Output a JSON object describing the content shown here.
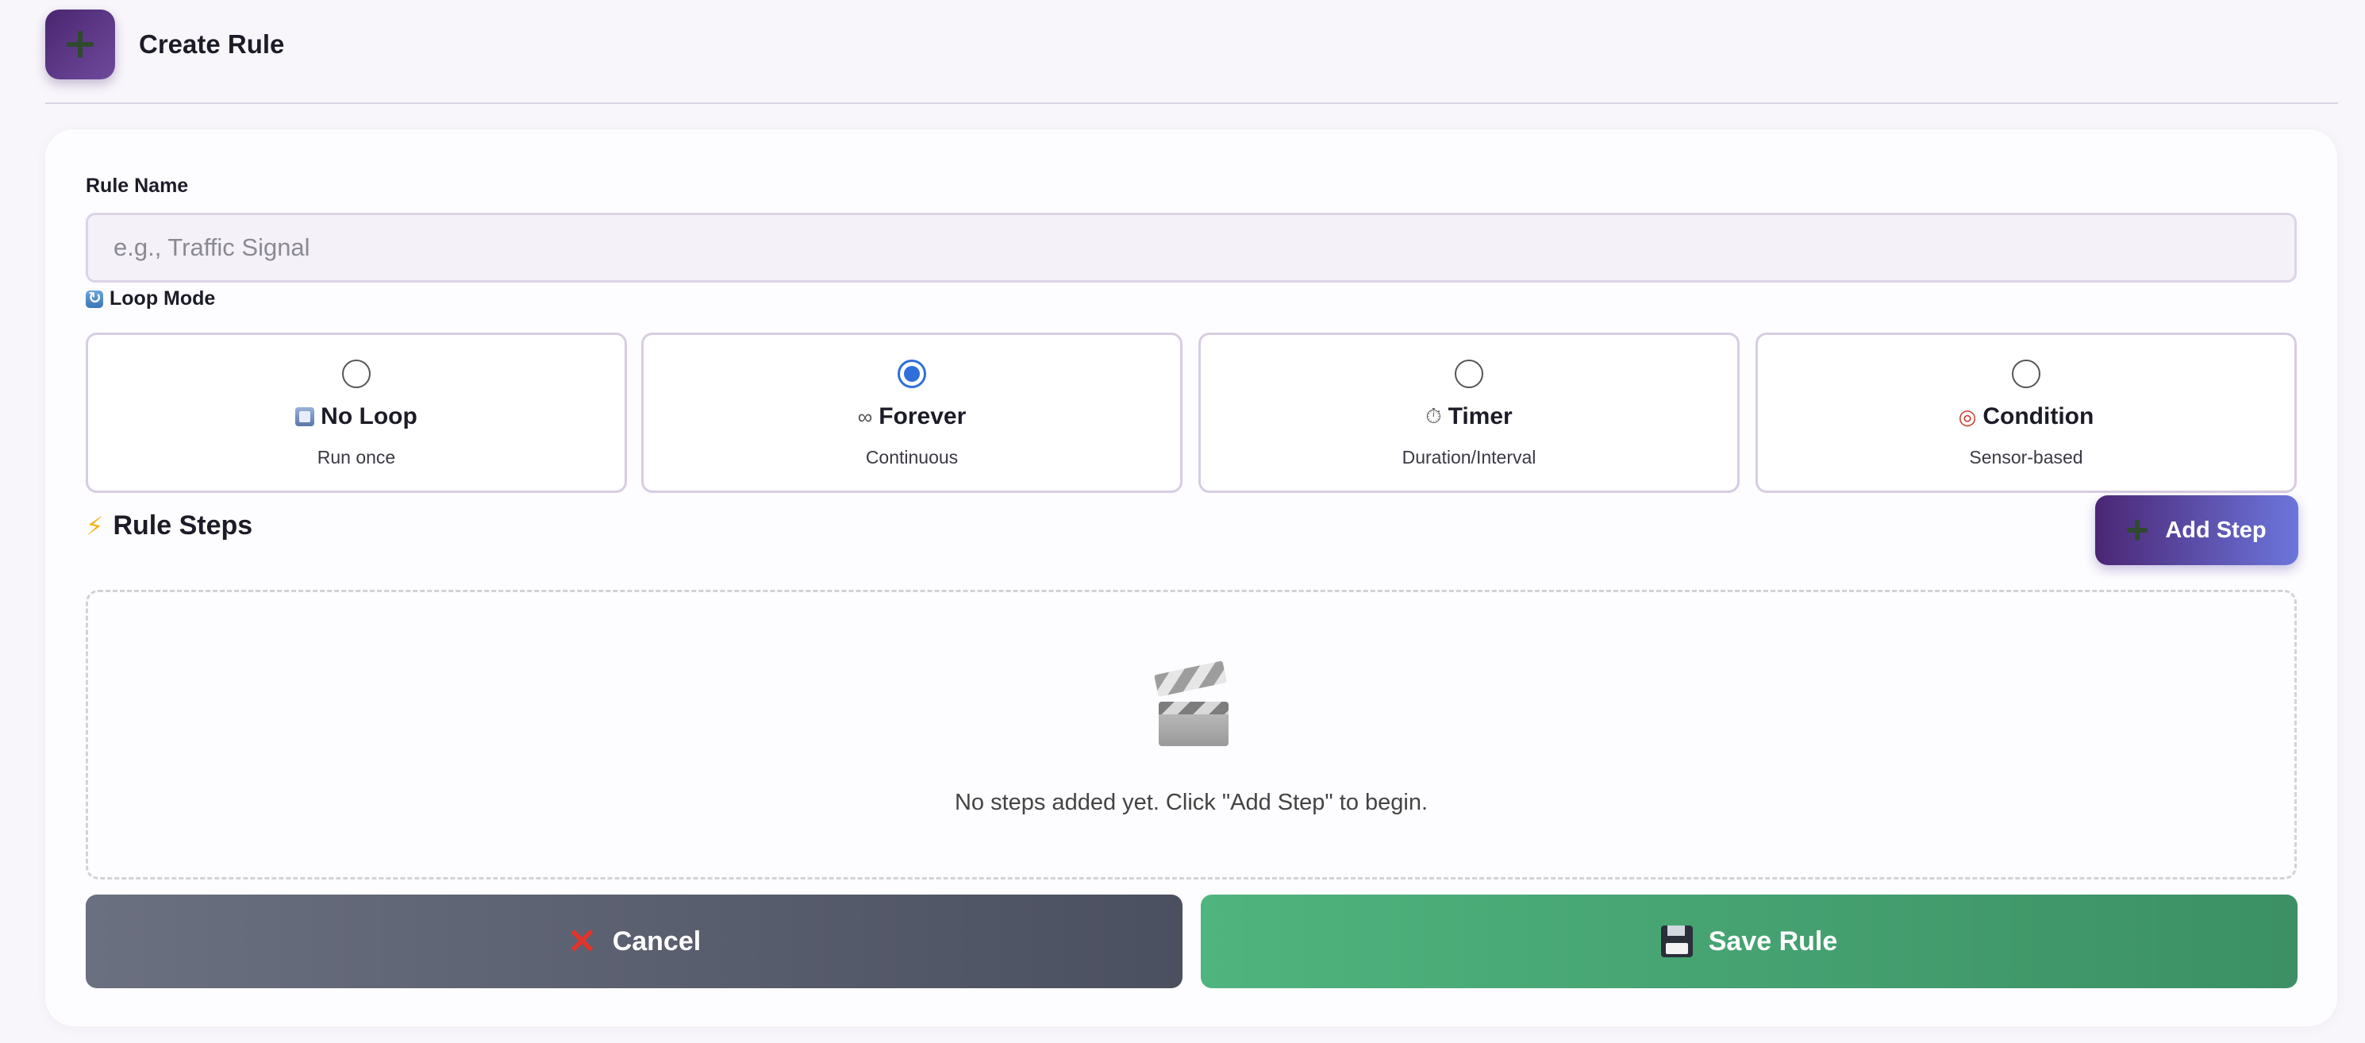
{
  "header": {
    "title": "Create Rule",
    "icon": "plus-icon"
  },
  "form": {
    "rule_name_label": "Rule Name",
    "rule_name_placeholder": "e.g., Traffic Signal",
    "rule_name_value": "",
    "loop_mode_label": "Loop Mode",
    "loop_options": [
      {
        "icon": "stop-square-icon",
        "title": "No Loop",
        "subtitle": "Run once",
        "selected": false
      },
      {
        "icon": "infinity-icon",
        "title": "Forever",
        "subtitle": "Continuous",
        "selected": true
      },
      {
        "icon": "stopwatch-icon",
        "title": "Timer",
        "subtitle": "Duration/Interval",
        "selected": false
      },
      {
        "icon": "target-icon",
        "title": "Condition",
        "subtitle": "Sensor-based",
        "selected": false
      }
    ],
    "steps_title": "Rule Steps",
    "add_step_label": "Add Step",
    "empty_steps_text": "No steps added yet. Click \"Add Step\" to begin.",
    "cancel_label": "Cancel",
    "save_label": "Save Rule"
  },
  "colors": {
    "accent_purple": "#4b2674",
    "radio_blue": "#2f6fd9",
    "save_green": "#4fb47e",
    "cancel_gray": "#5b6070"
  }
}
